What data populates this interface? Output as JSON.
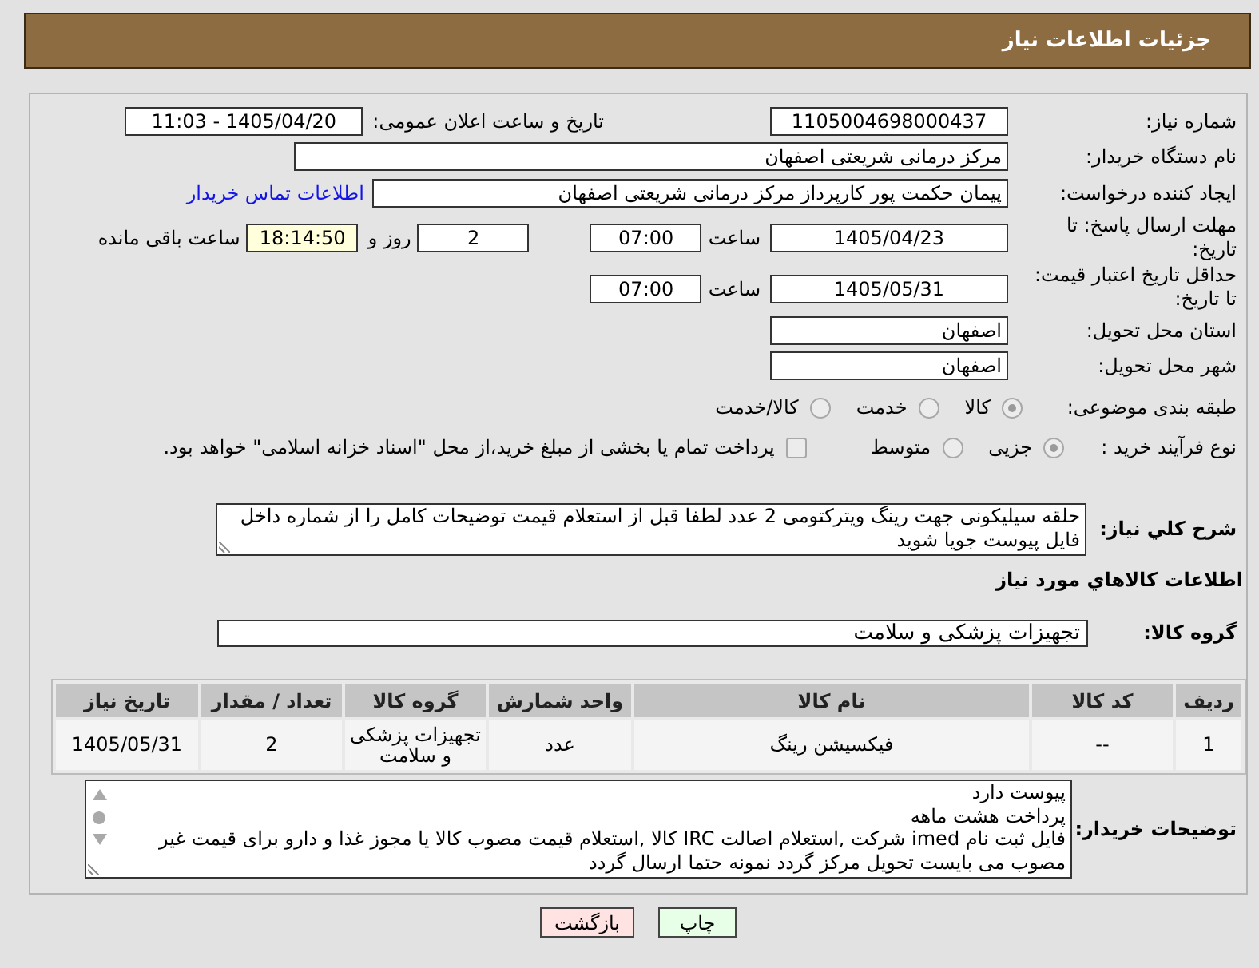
{
  "header": {
    "title": "جزئیات اطلاعات نیاز"
  },
  "need_number": {
    "label": "شماره نیاز:",
    "value": "1105004698000437"
  },
  "announcement": {
    "label": "تاریخ و ساعت اعلان عمومی:",
    "value": "1405/04/20 - 11:03"
  },
  "buyer_org": {
    "label": "نام دستگاه خریدار:",
    "value": "مرکز درمانی شریعتی اصفهان"
  },
  "requester": {
    "label": "ایجاد کننده درخواست:",
    "value": "پیمان حکمت پور کارپرداز مرکز درمانی شریعتی اصفهان",
    "contact_link": "اطلاعات تماس خریدار"
  },
  "reply_deadline": {
    "label": "مهلت ارسال پاسخ: تا تاریخ:",
    "date": "1405/04/23",
    "time_label": "ساعت",
    "time": "07:00",
    "days": "2",
    "days_label": "روز و",
    "remaining": "18:14:50",
    "remaining_label": "ساعت باقی مانده"
  },
  "price_validity": {
    "label": "حداقل تاریخ اعتبار قیمت: تا تاریخ:",
    "date": "1405/05/31",
    "time_label": "ساعت",
    "time": "07:00"
  },
  "delivery_province": {
    "label": "استان محل تحویل:",
    "value": "اصفهان"
  },
  "delivery_city": {
    "label": "شهر محل تحویل:",
    "value": "اصفهان"
  },
  "category": {
    "label": "طبقه بندی موضوعی:",
    "options": [
      {
        "label": "کالا",
        "selected": true
      },
      {
        "label": "خدمت",
        "selected": false
      },
      {
        "label": "کالا/خدمت",
        "selected": false
      }
    ]
  },
  "purchase_type": {
    "label": "نوع فرآیند خرید :",
    "options": [
      {
        "label": "جزیی",
        "selected": true
      },
      {
        "label": "متوسط",
        "selected": false
      }
    ],
    "treasury_payment": {
      "label": "پرداخت تمام یا بخشی از مبلغ خرید،از محل \"اسناد خزانه اسلامی\" خواهد بود.",
      "checked": false
    }
  },
  "description": {
    "label": "شرح کلي نیاز:",
    "value": "حلقه سیلیکونی جهت رینگ ویترکتومی 2 عدد لطفا قبل از استعلام قیمت توضیحات کامل را از شماره داخل فایل پیوست جویا شوید"
  },
  "goods_section": {
    "title": "اطلاعات کالاهاي مورد نیاز"
  },
  "goods_group": {
    "label": "گروه کالا:",
    "value": "تجهیزات پزشکی و سلامت"
  },
  "goods_table": {
    "columns": [
      "ردیف",
      "کد کالا",
      "نام کالا",
      "واحد شمارش",
      "گروه کالا",
      "تعداد / مقدار",
      "تاریخ نیاز"
    ],
    "rows": [
      [
        "1",
        "--",
        "فیکسیشن رینگ",
        "عدد",
        "تجهیزات پزشکی و سلامت",
        "2",
        "1405/05/31"
      ]
    ]
  },
  "buyer_notes": {
    "label": "توضیحات خریدار:",
    "value": "پیوست دارد\nپرداخت هشت ماهه\nفایل ثبت نام imed شرکت ,استعلام اصالت IRC کالا ,استعلام قیمت مصوب کالا یا مجوز غذا و دارو برای قیمت غیر مصوب می بایست تحویل مرکز گردد نمونه حتما ارسال گردد"
  },
  "buttons": [
    {
      "label": "چاپ",
      "kind": "print"
    },
    {
      "label": "بازگشت",
      "kind": "back"
    }
  ]
}
